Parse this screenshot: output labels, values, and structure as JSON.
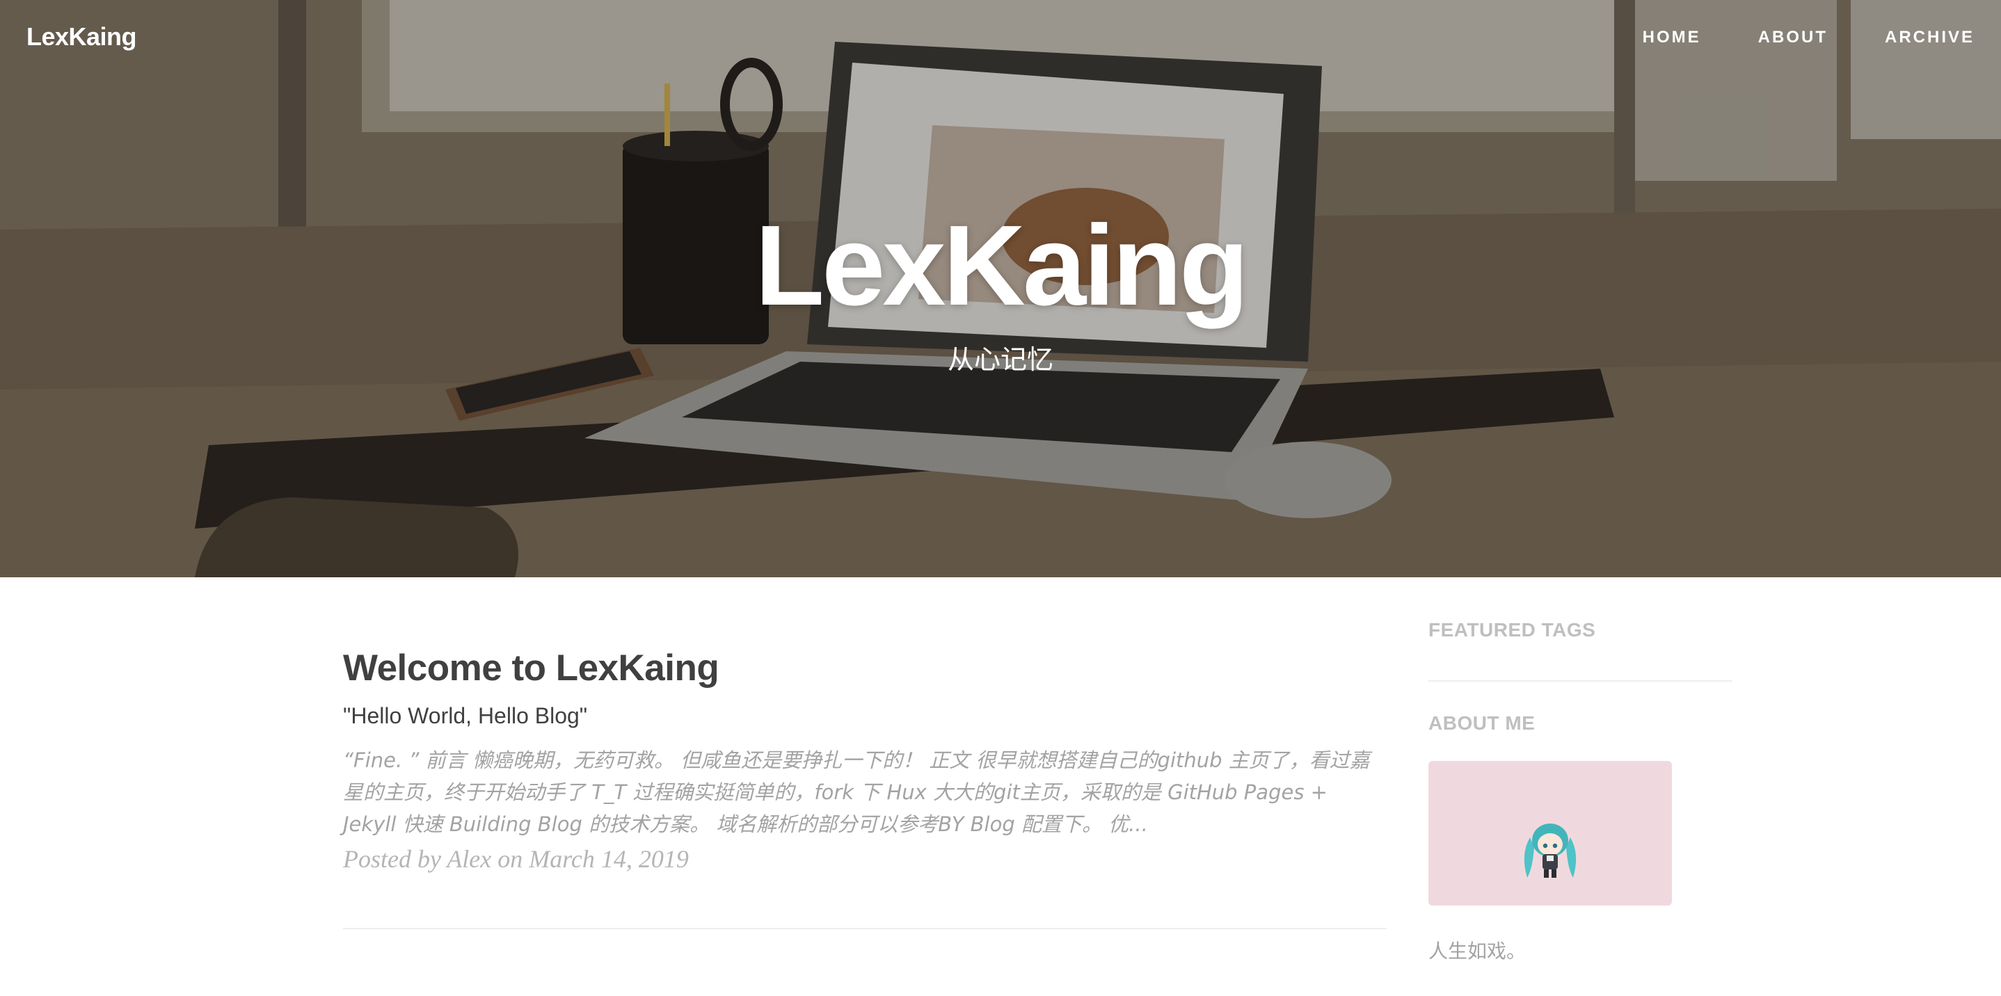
{
  "navbar": {
    "brand": "LexKaing",
    "links": [
      "HOME",
      "ABOUT",
      "ARCHIVE"
    ]
  },
  "hero": {
    "title": "LexKaing",
    "subtitle": "从心记忆"
  },
  "posts": [
    {
      "title": "Welcome to LexKaing",
      "subtitle": "\"Hello World, Hello Blog\"",
      "excerpt": "“Fine. ” 前言 懒癌晚期，无药可救。 但咸鱼还是要挣扎一下的！ 正文 很早就想搭建自己的github 主页了，看过嘉星的主页，终于开始动手了 T_T 过程确实挺简单的，fork 下 Hux 大大的git主页，采取的是 GitHub Pages + Jekyll 快速 Building Blog 的技术方案。 域名解析的部分可以参考BY Blog 配置下。 优...",
      "meta": "Posted by Alex on March 14, 2019"
    }
  ],
  "sidebar": {
    "featured_tags_heading": "FEATURED TAGS",
    "about_heading": "ABOUT ME",
    "bio": "人生如戏。"
  },
  "colors": {
    "text_dark": "#404040",
    "text_muted": "#a3a3a3",
    "sidebar_heading": "#bfbfbf",
    "avatar_bg": "#f0d9de",
    "avatar_hair": "#4fc3c7"
  },
  "icons": {
    "avatar": "chibi-character-avatar"
  }
}
